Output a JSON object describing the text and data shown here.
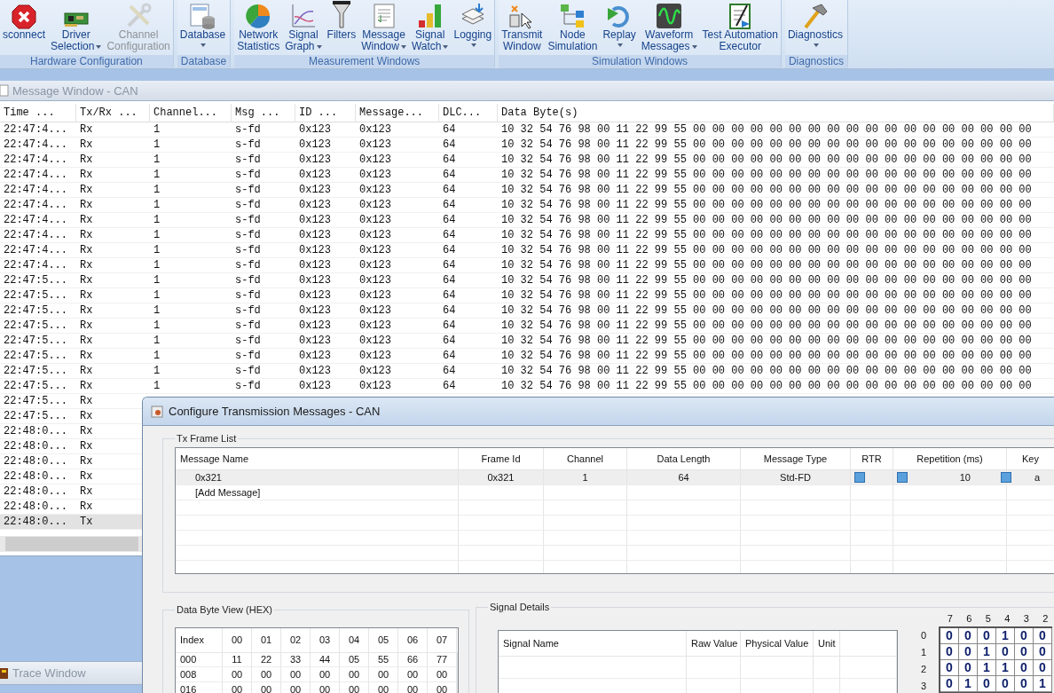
{
  "ribbon": {
    "groups": [
      {
        "label": "Hardware Configuration",
        "buttons": [
          {
            "lines": [
              "sconnect"
            ],
            "dropdown": false,
            "disabled": false
          },
          {
            "lines": [
              "Driver",
              "Selection"
            ],
            "dropdown": true,
            "disabled": false
          },
          {
            "lines": [
              "Channel",
              "Configuration"
            ],
            "dropdown": false,
            "disabled": true
          }
        ]
      },
      {
        "label": "Database",
        "buttons": [
          {
            "lines": [
              "Database"
            ],
            "dropdown": true,
            "disabled": false
          }
        ]
      },
      {
        "label": "Measurement Windows",
        "buttons": [
          {
            "lines": [
              "Network",
              "Statistics"
            ],
            "dropdown": false,
            "disabled": false
          },
          {
            "lines": [
              "Signal",
              "Graph"
            ],
            "dropdown": true,
            "disabled": false
          },
          {
            "lines": [
              "Filters"
            ],
            "dropdown": false,
            "disabled": false
          },
          {
            "lines": [
              "Message",
              "Window"
            ],
            "dropdown": true,
            "disabled": false
          },
          {
            "lines": [
              "Signal",
              "Watch"
            ],
            "dropdown": true,
            "disabled": false
          },
          {
            "lines": [
              "Logging"
            ],
            "dropdown": true,
            "disabled": false
          }
        ]
      },
      {
        "label": "Simulation Windows",
        "buttons": [
          {
            "lines": [
              "Transmit",
              "Window"
            ],
            "dropdown": false,
            "disabled": false
          },
          {
            "lines": [
              "Node",
              "Simulation"
            ],
            "dropdown": false,
            "disabled": false
          },
          {
            "lines": [
              "Replay"
            ],
            "dropdown": true,
            "disabled": false
          },
          {
            "lines": [
              "Waveform",
              "Messages"
            ],
            "dropdown": true,
            "disabled": false
          },
          {
            "lines": [
              "Test Automation",
              "Executor"
            ],
            "dropdown": false,
            "disabled": false
          }
        ]
      },
      {
        "label": "Diagnostics",
        "buttons": [
          {
            "lines": [
              "Diagnostics"
            ],
            "dropdown": true,
            "disabled": false
          }
        ]
      }
    ]
  },
  "message_window": {
    "title": "Message Window - CAN",
    "columns": [
      "Time ...",
      "Tx/Rx ...",
      "Channel...",
      "Msg ...",
      "ID ...",
      "Message...",
      "DLC...",
      "Data Byte(s)"
    ],
    "rows": [
      {
        "time": "22:47:4...",
        "direction": "Rx",
        "channel": "1",
        "msg": "s-fd",
        "id": "0x123",
        "message": "0x123",
        "dlc": "64",
        "data": "10 32 54 76 98 00 11 22 99 55 00 00 00 00 00 00 00 00 00 00 00 00 00 00 00 00 00 00",
        "selected": false
      },
      {
        "time": "22:47:4...",
        "direction": "Rx",
        "channel": "1",
        "msg": "s-fd",
        "id": "0x123",
        "message": "0x123",
        "dlc": "64",
        "data": "10 32 54 76 98 00 11 22 99 55 00 00 00 00 00 00 00 00 00 00 00 00 00 00 00 00 00 00",
        "selected": false
      },
      {
        "time": "22:47:4...",
        "direction": "Rx",
        "channel": "1",
        "msg": "s-fd",
        "id": "0x123",
        "message": "0x123",
        "dlc": "64",
        "data": "10 32 54 76 98 00 11 22 99 55 00 00 00 00 00 00 00 00 00 00 00 00 00 00 00 00 00 00",
        "selected": false
      },
      {
        "time": "22:47:4...",
        "direction": "Rx",
        "channel": "1",
        "msg": "s-fd",
        "id": "0x123",
        "message": "0x123",
        "dlc": "64",
        "data": "10 32 54 76 98 00 11 22 99 55 00 00 00 00 00 00 00 00 00 00 00 00 00 00 00 00 00 00",
        "selected": false
      },
      {
        "time": "22:47:4...",
        "direction": "Rx",
        "channel": "1",
        "msg": "s-fd",
        "id": "0x123",
        "message": "0x123",
        "dlc": "64",
        "data": "10 32 54 76 98 00 11 22 99 55 00 00 00 00 00 00 00 00 00 00 00 00 00 00 00 00 00 00",
        "selected": false
      },
      {
        "time": "22:47:4...",
        "direction": "Rx",
        "channel": "1",
        "msg": "s-fd",
        "id": "0x123",
        "message": "0x123",
        "dlc": "64",
        "data": "10 32 54 76 98 00 11 22 99 55 00 00 00 00 00 00 00 00 00 00 00 00 00 00 00 00 00 00",
        "selected": false
      },
      {
        "time": "22:47:4...",
        "direction": "Rx",
        "channel": "1",
        "msg": "s-fd",
        "id": "0x123",
        "message": "0x123",
        "dlc": "64",
        "data": "10 32 54 76 98 00 11 22 99 55 00 00 00 00 00 00 00 00 00 00 00 00 00 00 00 00 00 00",
        "selected": false
      },
      {
        "time": "22:47:4...",
        "direction": "Rx",
        "channel": "1",
        "msg": "s-fd",
        "id": "0x123",
        "message": "0x123",
        "dlc": "64",
        "data": "10 32 54 76 98 00 11 22 99 55 00 00 00 00 00 00 00 00 00 00 00 00 00 00 00 00 00 00",
        "selected": false
      },
      {
        "time": "22:47:4...",
        "direction": "Rx",
        "channel": "1",
        "msg": "s-fd",
        "id": "0x123",
        "message": "0x123",
        "dlc": "64",
        "data": "10 32 54 76 98 00 11 22 99 55 00 00 00 00 00 00 00 00 00 00 00 00 00 00 00 00 00 00",
        "selected": false
      },
      {
        "time": "22:47:4...",
        "direction": "Rx",
        "channel": "1",
        "msg": "s-fd",
        "id": "0x123",
        "message": "0x123",
        "dlc": "64",
        "data": "10 32 54 76 98 00 11 22 99 55 00 00 00 00 00 00 00 00 00 00 00 00 00 00 00 00 00 00",
        "selected": false
      },
      {
        "time": "22:47:5...",
        "direction": "Rx",
        "channel": "1",
        "msg": "s-fd",
        "id": "0x123",
        "message": "0x123",
        "dlc": "64",
        "data": "10 32 54 76 98 00 11 22 99 55 00 00 00 00 00 00 00 00 00 00 00 00 00 00 00 00 00 00",
        "selected": false
      },
      {
        "time": "22:47:5...",
        "direction": "Rx",
        "channel": "1",
        "msg": "s-fd",
        "id": "0x123",
        "message": "0x123",
        "dlc": "64",
        "data": "10 32 54 76 98 00 11 22 99 55 00 00 00 00 00 00 00 00 00 00 00 00 00 00 00 00 00 00",
        "selected": false
      },
      {
        "time": "22:47:5...",
        "direction": "Rx",
        "channel": "1",
        "msg": "s-fd",
        "id": "0x123",
        "message": "0x123",
        "dlc": "64",
        "data": "10 32 54 76 98 00 11 22 99 55 00 00 00 00 00 00 00 00 00 00 00 00 00 00 00 00 00 00",
        "selected": false
      },
      {
        "time": "22:47:5...",
        "direction": "Rx",
        "channel": "1",
        "msg": "s-fd",
        "id": "0x123",
        "message": "0x123",
        "dlc": "64",
        "data": "10 32 54 76 98 00 11 22 99 55 00 00 00 00 00 00 00 00 00 00 00 00 00 00 00 00 00 00",
        "selected": false
      },
      {
        "time": "22:47:5...",
        "direction": "Rx",
        "channel": "1",
        "msg": "s-fd",
        "id": "0x123",
        "message": "0x123",
        "dlc": "64",
        "data": "10 32 54 76 98 00 11 22 99 55 00 00 00 00 00 00 00 00 00 00 00 00 00 00 00 00 00 00",
        "selected": false
      },
      {
        "time": "22:47:5...",
        "direction": "Rx",
        "channel": "1",
        "msg": "s-fd",
        "id": "0x123",
        "message": "0x123",
        "dlc": "64",
        "data": "10 32 54 76 98 00 11 22 99 55 00 00 00 00 00 00 00 00 00 00 00 00 00 00 00 00 00 00",
        "selected": false
      },
      {
        "time": "22:47:5...",
        "direction": "Rx",
        "channel": "1",
        "msg": "s-fd",
        "id": "0x123",
        "message": "0x123",
        "dlc": "64",
        "data": "10 32 54 76 98 00 11 22 99 55 00 00 00 00 00 00 00 00 00 00 00 00 00 00 00 00 00 00",
        "selected": false
      },
      {
        "time": "22:47:5...",
        "direction": "Rx",
        "channel": "1",
        "msg": "s-fd",
        "id": "0x123",
        "message": "0x123",
        "dlc": "64",
        "data": "10 32 54 76 98 00 11 22 99 55 00 00 00 00 00 00 00 00 00 00 00 00 00 00 00 00 00 00",
        "selected": false
      },
      {
        "time": "22:47:5...",
        "direction": "Rx",
        "selected": false
      },
      {
        "time": "22:47:5...",
        "direction": "Rx",
        "selected": false
      },
      {
        "time": "22:48:0...",
        "direction": "Rx",
        "selected": false
      },
      {
        "time": "22:48:0...",
        "direction": "Rx",
        "selected": false
      },
      {
        "time": "22:48:0...",
        "direction": "Rx",
        "selected": false
      },
      {
        "time": "22:48:0...",
        "direction": "Rx",
        "selected": false
      },
      {
        "time": "22:48:0...",
        "direction": "Rx",
        "selected": false
      },
      {
        "time": "22:48:0...",
        "direction": "Rx",
        "selected": false
      },
      {
        "time": "22:48:0...",
        "direction": "Tx",
        "selected": true
      }
    ]
  },
  "trace_window": {
    "title": "Trace Window"
  },
  "dialog": {
    "title": "Configure Transmission Messages - CAN",
    "tx_frame_list": {
      "label": "Tx Frame List",
      "columns": [
        "Message Name",
        "Frame Id",
        "Channel",
        "Data Length",
        "Message Type",
        "RTR",
        "Repetition (ms)",
        "Key"
      ],
      "rows": [
        {
          "kind": "message",
          "message_name": "0x321",
          "frame_id": "0x321",
          "channel": "1",
          "data_length": "64",
          "message_type": "Std-FD",
          "rtr": false,
          "repetition_enabled": false,
          "repetition": "10",
          "key_enabled": false,
          "key": "a",
          "selected": true
        },
        {
          "kind": "add",
          "message_name": "[Add Message]",
          "selected": false
        }
      ]
    },
    "data_byte_view": {
      "label": "Data Byte View (HEX)",
      "columns": [
        "Index",
        "00",
        "01",
        "02",
        "03",
        "04",
        "05",
        "06",
        "07"
      ],
      "rows": [
        {
          "index": "000",
          "bytes": [
            "11",
            "22",
            "33",
            "44",
            "05",
            "55",
            "66",
            "77"
          ]
        },
        {
          "index": "008",
          "bytes": [
            "00",
            "00",
            "00",
            "00",
            "00",
            "00",
            "00",
            "00"
          ]
        },
        {
          "index": "016",
          "bytes": [
            "00",
            "00",
            "00",
            "00",
            "00",
            "00",
            "00",
            "00"
          ]
        }
      ]
    },
    "signal_details": {
      "label": "Signal Details",
      "columns": [
        "Signal Name",
        "Raw Value",
        "Physical Value",
        "Unit"
      ]
    },
    "bit_grid": {
      "column_labels": [
        "7",
        "6",
        "5",
        "4",
        "3",
        "2"
      ],
      "rows": [
        {
          "label": "0",
          "bits": [
            "0",
            "0",
            "0",
            "1",
            "0",
            "0"
          ]
        },
        {
          "label": "1",
          "bits": [
            "0",
            "0",
            "1",
            "0",
            "0",
            "0"
          ]
        },
        {
          "label": "2",
          "bits": [
            "0",
            "0",
            "1",
            "1",
            "0",
            "0"
          ]
        },
        {
          "label": "3",
          "bits": [
            "0",
            "1",
            "0",
            "0",
            "0",
            "1"
          ]
        }
      ]
    }
  }
}
